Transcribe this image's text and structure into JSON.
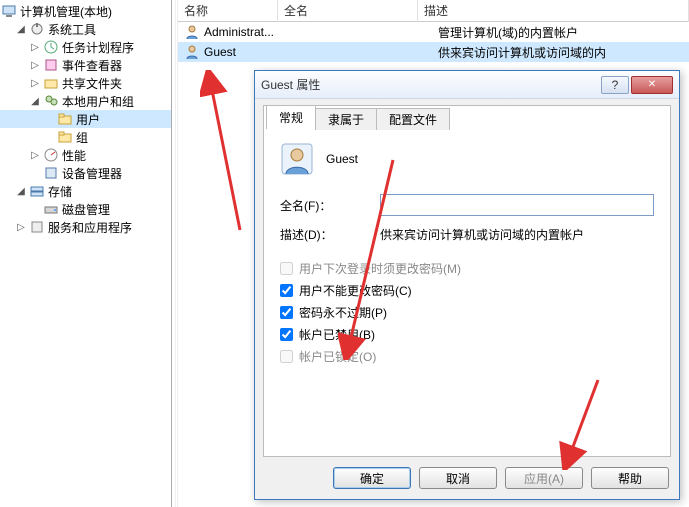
{
  "tree": {
    "root": "计算机管理(本地)",
    "system_tools": "系统工具",
    "task_scheduler": "任务计划程序",
    "event_viewer": "事件查看器",
    "shared_folders": "共享文件夹",
    "local_users_groups": "本地用户和组",
    "users": "用户",
    "groups": "组",
    "performance": "性能",
    "device_manager": "设备管理器",
    "storage": "存储",
    "disk_management": "磁盘管理",
    "services_apps": "服务和应用程序"
  },
  "list": {
    "columns": {
      "name": "名称",
      "fullname": "全名",
      "desc": "描述"
    },
    "rows": [
      {
        "name": "Administrat...",
        "fullname": "",
        "desc": "管理计算机(域)的内置帐户"
      },
      {
        "name": "Guest",
        "fullname": "",
        "desc": "供来宾访问计算机或访问域的内"
      }
    ]
  },
  "dialog": {
    "title": "Guest 属性",
    "tabs": {
      "general": "常规",
      "memberof": "隶属于",
      "profile": "配置文件"
    },
    "username": "Guest",
    "fullname_label": "全名(F)：",
    "fullname_value": "",
    "desc_label": "描述(D)：",
    "desc_value": "供来宾访问计算机或访问域的内置帐户",
    "checks": {
      "must_change": "用户下次登录时须更改密码(M)",
      "cannot_change": "用户不能更改密码(C)",
      "never_expire": "密码永不过期(P)",
      "disabled": "帐户已禁用(B)",
      "locked": "帐户已锁定(O)"
    },
    "check_state": {
      "must_change": false,
      "cannot_change": true,
      "never_expire": true,
      "disabled": true,
      "locked": false
    },
    "buttons": {
      "ok": "确定",
      "cancel": "取消",
      "apply": "应用(A)",
      "help": "帮助"
    }
  },
  "glyphs": {
    "collapsed": "▷",
    "expanded": "◢",
    "question": "?",
    "close": "✕"
  }
}
